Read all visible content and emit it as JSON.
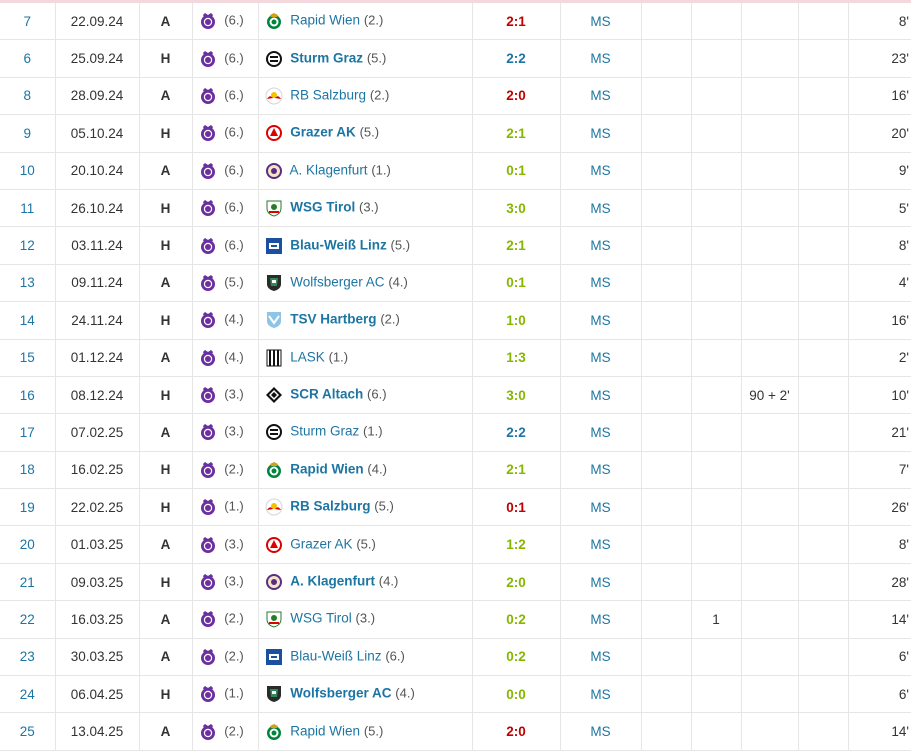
{
  "colors": {
    "link_blue": "#1d75a3",
    "result_red": "#c00000",
    "result_green": "#86b600",
    "result_blue": "#1d75a3",
    "austria_violet": "#6b2fa0"
  },
  "rows": [
    {
      "matchday": "7",
      "date": "22.09.24",
      "venue": "A",
      "own_rank": "(6.)",
      "opp_icon": "rapid-wien-crest",
      "opponent": "Rapid Wien",
      "opp_bold": false,
      "opp_rank": "(2.)",
      "result": "2:1",
      "result_type": "red",
      "position": "MS",
      "c1": "",
      "c2": "",
      "c3": "",
      "c4": "",
      "minutes": "8'"
    },
    {
      "matchday": "6",
      "date": "25.09.24",
      "venue": "H",
      "own_rank": "(6.)",
      "opp_icon": "sturm-graz-crest",
      "opponent": "Sturm Graz",
      "opp_bold": true,
      "opp_rank": "(5.)",
      "result": "2:2",
      "result_type": "blue",
      "position": "MS",
      "c1": "",
      "c2": "",
      "c3": "",
      "c4": "",
      "minutes": "23'"
    },
    {
      "matchday": "8",
      "date": "28.09.24",
      "venue": "A",
      "own_rank": "(6.)",
      "opp_icon": "rb-salzburg-crest",
      "opponent": "RB Salzburg",
      "opp_bold": false,
      "opp_rank": "(2.)",
      "result": "2:0",
      "result_type": "red",
      "position": "MS",
      "c1": "",
      "c2": "",
      "c3": "",
      "c4": "",
      "minutes": "16'"
    },
    {
      "matchday": "9",
      "date": "05.10.24",
      "venue": "H",
      "own_rank": "(6.)",
      "opp_icon": "grazer-ak-crest",
      "opponent": "Grazer AK",
      "opp_bold": true,
      "opp_rank": "(5.)",
      "result": "2:1",
      "result_type": "green",
      "position": "MS",
      "c1": "",
      "c2": "",
      "c3": "",
      "c4": "",
      "minutes": "20'"
    },
    {
      "matchday": "10",
      "date": "20.10.24",
      "venue": "A",
      "own_rank": "(6.)",
      "opp_icon": "a-klagenfurt-crest",
      "opponent": "A. Klagenfurt",
      "opp_bold": false,
      "opp_rank": "(1.)",
      "result": "0:1",
      "result_type": "green",
      "position": "MS",
      "c1": "",
      "c2": "",
      "c3": "",
      "c4": "",
      "minutes": "9'"
    },
    {
      "matchday": "11",
      "date": "26.10.24",
      "venue": "H",
      "own_rank": "(6.)",
      "opp_icon": "wsg-tirol-crest",
      "opponent": "WSG Tirol",
      "opp_bold": true,
      "opp_rank": "(3.)",
      "result": "3:0",
      "result_type": "green",
      "position": "MS",
      "c1": "",
      "c2": "",
      "c3": "",
      "c4": "",
      "minutes": "5'"
    },
    {
      "matchday": "12",
      "date": "03.11.24",
      "venue": "H",
      "own_rank": "(6.)",
      "opp_icon": "blau-weiss-linz-crest",
      "opponent": "Blau-Weiß Linz",
      "opp_bold": true,
      "opp_rank": "(5.)",
      "result": "2:1",
      "result_type": "green",
      "position": "MS",
      "c1": "",
      "c2": "",
      "c3": "",
      "c4": "",
      "minutes": "8'"
    },
    {
      "matchday": "13",
      "date": "09.11.24",
      "venue": "A",
      "own_rank": "(5.)",
      "opp_icon": "wolfsberger-ac-crest",
      "opponent": "Wolfsberger AC",
      "opp_bold": false,
      "opp_rank": "(4.)",
      "result": "0:1",
      "result_type": "green",
      "position": "MS",
      "c1": "",
      "c2": "",
      "c3": "",
      "c4": "",
      "minutes": "4'"
    },
    {
      "matchday": "14",
      "date": "24.11.24",
      "venue": "H",
      "own_rank": "(4.)",
      "opp_icon": "tsv-hartberg-crest",
      "opponent": "TSV Hartberg",
      "opp_bold": true,
      "opp_rank": "(2.)",
      "result": "1:0",
      "result_type": "green",
      "position": "MS",
      "c1": "",
      "c2": "",
      "c3": "",
      "c4": "",
      "minutes": "16'"
    },
    {
      "matchday": "15",
      "date": "01.12.24",
      "venue": "A",
      "own_rank": "(4.)",
      "opp_icon": "lask-crest",
      "opponent": "LASK",
      "opp_bold": false,
      "opp_rank": "(1.)",
      "result": "1:3",
      "result_type": "green",
      "position": "MS",
      "c1": "",
      "c2": "",
      "c3": "",
      "c4": "",
      "minutes": "2'"
    },
    {
      "matchday": "16",
      "date": "08.12.24",
      "venue": "H",
      "own_rank": "(3.)",
      "opp_icon": "scr-altach-crest",
      "opponent": "SCR Altach",
      "opp_bold": true,
      "opp_rank": "(6.)",
      "result": "3:0",
      "result_type": "green",
      "position": "MS",
      "c1": "",
      "c2": "",
      "c3": "90 + 2'",
      "c4": "",
      "minutes": "10'"
    },
    {
      "matchday": "17",
      "date": "07.02.25",
      "venue": "A",
      "own_rank": "(3.)",
      "opp_icon": "sturm-graz-crest",
      "opponent": "Sturm Graz",
      "opp_bold": false,
      "opp_rank": "(1.)",
      "result": "2:2",
      "result_type": "blue",
      "position": "MS",
      "c1": "",
      "c2": "",
      "c3": "",
      "c4": "",
      "minutes": "21'"
    },
    {
      "matchday": "18",
      "date": "16.02.25",
      "venue": "H",
      "own_rank": "(2.)",
      "opp_icon": "rapid-wien-crest",
      "opponent": "Rapid Wien",
      "opp_bold": true,
      "opp_rank": "(4.)",
      "result": "2:1",
      "result_type": "green",
      "position": "MS",
      "c1": "",
      "c2": "",
      "c3": "",
      "c4": "",
      "minutes": "7'"
    },
    {
      "matchday": "19",
      "date": "22.02.25",
      "venue": "H",
      "own_rank": "(1.)",
      "opp_icon": "rb-salzburg-crest",
      "opponent": "RB Salzburg",
      "opp_bold": true,
      "opp_rank": "(5.)",
      "result": "0:1",
      "result_type": "red",
      "position": "MS",
      "c1": "",
      "c2": "",
      "c3": "",
      "c4": "",
      "minutes": "26'"
    },
    {
      "matchday": "20",
      "date": "01.03.25",
      "venue": "A",
      "own_rank": "(3.)",
      "opp_icon": "grazer-ak-crest",
      "opponent": "Grazer AK",
      "opp_bold": false,
      "opp_rank": "(5.)",
      "result": "1:2",
      "result_type": "green",
      "position": "MS",
      "c1": "",
      "c2": "",
      "c3": "",
      "c4": "",
      "minutes": "8'"
    },
    {
      "matchday": "21",
      "date": "09.03.25",
      "venue": "H",
      "own_rank": "(3.)",
      "opp_icon": "a-klagenfurt-crest",
      "opponent": "A. Klagenfurt",
      "opp_bold": true,
      "opp_rank": "(4.)",
      "result": "2:0",
      "result_type": "green",
      "position": "MS",
      "c1": "",
      "c2": "",
      "c3": "",
      "c4": "",
      "minutes": "28'"
    },
    {
      "matchday": "22",
      "date": "16.03.25",
      "venue": "A",
      "own_rank": "(2.)",
      "opp_icon": "wsg-tirol-crest",
      "opponent": "WSG Tirol",
      "opp_bold": false,
      "opp_rank": "(3.)",
      "result": "0:2",
      "result_type": "green",
      "position": "MS",
      "c1": "",
      "c2": "1",
      "c3": "",
      "c4": "",
      "minutes": "14'"
    },
    {
      "matchday": "23",
      "date": "30.03.25",
      "venue": "A",
      "own_rank": "(2.)",
      "opp_icon": "blau-weiss-linz-crest",
      "opponent": "Blau-Weiß Linz",
      "opp_bold": false,
      "opp_rank": "(6.)",
      "result": "0:2",
      "result_type": "green",
      "position": "MS",
      "c1": "",
      "c2": "",
      "c3": "",
      "c4": "",
      "minutes": "6'"
    },
    {
      "matchday": "24",
      "date": "06.04.25",
      "venue": "H",
      "own_rank": "(1.)",
      "opp_icon": "wolfsberger-ac-crest",
      "opponent": "Wolfsberger AC",
      "opp_bold": true,
      "opp_rank": "(4.)",
      "result": "0:0",
      "result_type": "green",
      "position": "MS",
      "c1": "",
      "c2": "",
      "c3": "",
      "c4": "",
      "minutes": "6'"
    },
    {
      "matchday": "25",
      "date": "13.04.25",
      "venue": "A",
      "own_rank": "(2.)",
      "opp_icon": "rapid-wien-crest",
      "opponent": "Rapid Wien",
      "opp_bold": false,
      "opp_rank": "(5.)",
      "result": "2:0",
      "result_type": "red",
      "position": "MS",
      "c1": "",
      "c2": "",
      "c3": "",
      "c4": "",
      "minutes": "14'"
    }
  ]
}
